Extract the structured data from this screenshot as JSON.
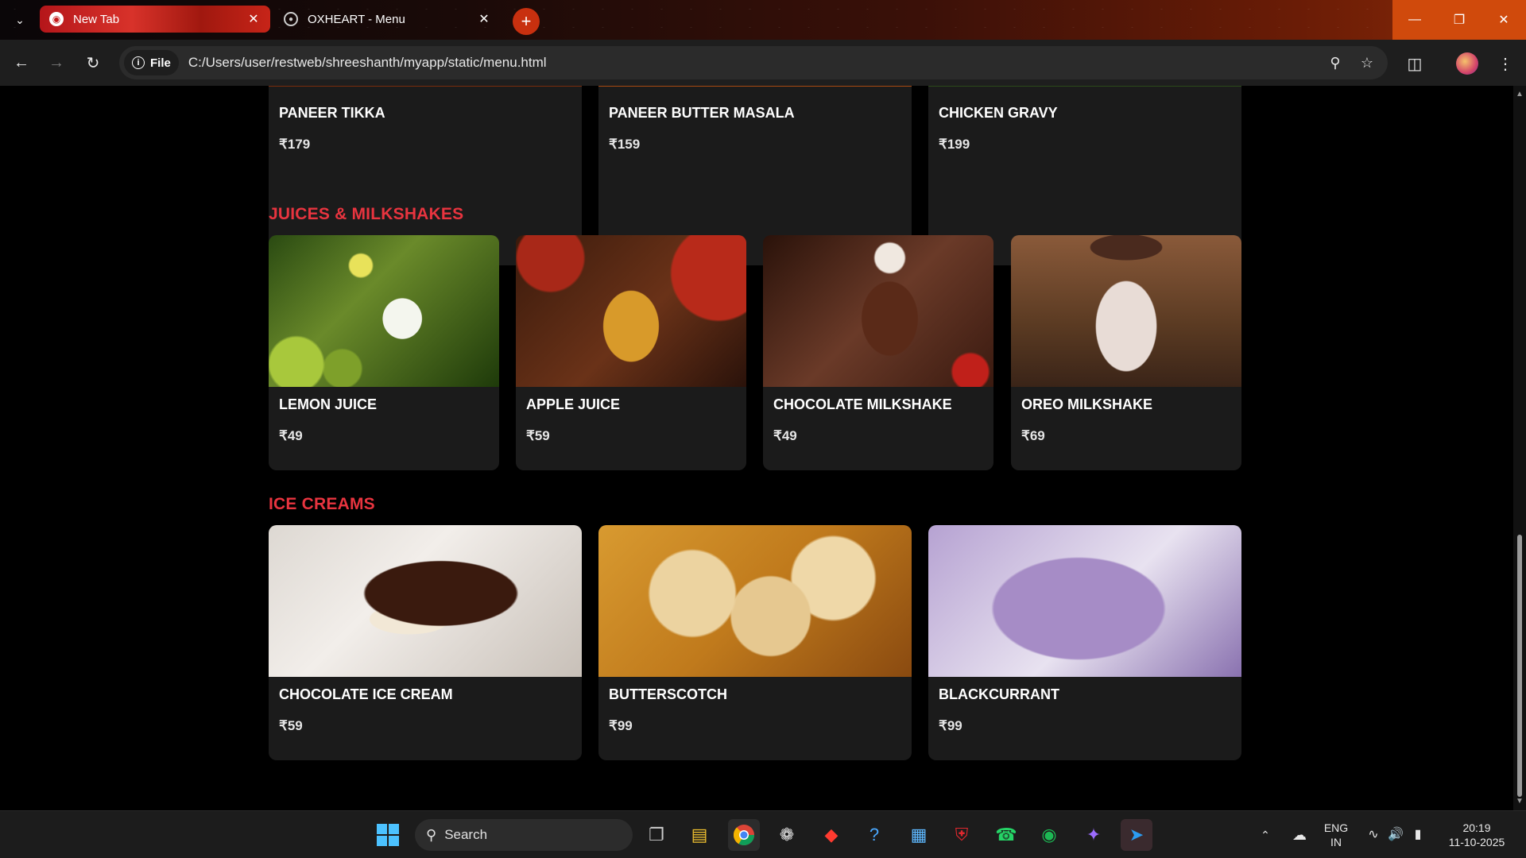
{
  "browser": {
    "tabs": [
      {
        "title": "New Tab",
        "active": true
      },
      {
        "title": "OXHEART - Menu",
        "active": false
      }
    ],
    "address": {
      "scheme_chip": "File",
      "url": "C:/Users/user/restweb/shreeshanth/myapp/static/menu.html"
    }
  },
  "menu": {
    "top_row": [
      {
        "name": "PANEER TIKKA",
        "price": "₹179"
      },
      {
        "name": "PANEER BUTTER MASALA",
        "price": "₹159"
      },
      {
        "name": "CHICKEN GRAVY",
        "price": "₹199"
      }
    ],
    "juices": {
      "title": "JUICES & MILKSHAKES",
      "items": [
        {
          "name": "LEMON JUICE",
          "price": "₹49"
        },
        {
          "name": "APPLE JUICE",
          "price": "₹59"
        },
        {
          "name": "CHOCOLATE MILKSHAKE",
          "price": "₹49"
        },
        {
          "name": "OREO MILKSHAKE",
          "price": "₹69"
        }
      ]
    },
    "icecreams": {
      "title": "ICE CREAMS",
      "items": [
        {
          "name": "CHOCOLATE ICE CREAM",
          "price": "₹59"
        },
        {
          "name": "BUTTERSCOTCH",
          "price": "₹99"
        },
        {
          "name": "BLACKCURRANT",
          "price": "₹99"
        }
      ]
    }
  },
  "taskbar": {
    "search_label": "Search",
    "language": {
      "line1": "ENG",
      "line2": "IN"
    },
    "clock": {
      "time": "20:19",
      "date": "11-10-2025"
    }
  },
  "colors": {
    "section_title": "#e8343f",
    "card_bg": "#1b1b1b",
    "page_bg": "#000000"
  }
}
